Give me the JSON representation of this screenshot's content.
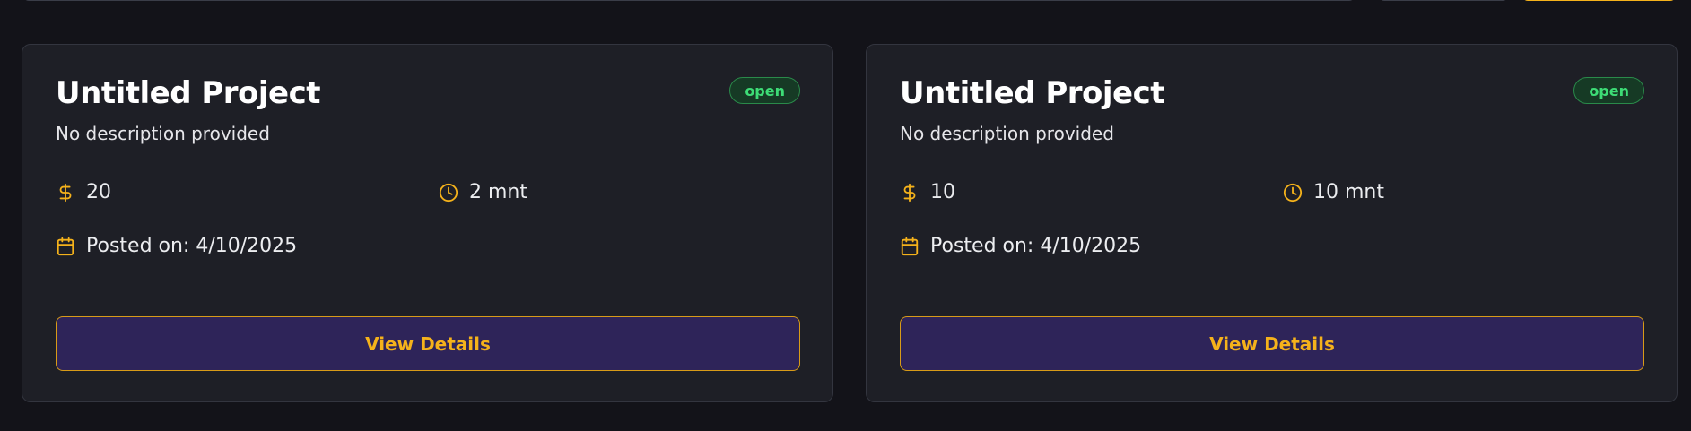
{
  "colors": {
    "accent": "#f5b21b",
    "background": "#131319",
    "card": "#1e1f26",
    "status_open": "#3ddc76",
    "button_bg": "#2e2459"
  },
  "projects": [
    {
      "title": "Untitled Project",
      "description": "No description provided",
      "status": "open",
      "price": "20",
      "duration": "2 mnt",
      "posted": "Posted on: 4/10/2025",
      "button_label": "View Details"
    },
    {
      "title": "Untitled Project",
      "description": "No description provided",
      "status": "open",
      "price": "10",
      "duration": "10 mnt",
      "posted": "Posted on: 4/10/2025",
      "button_label": "View Details"
    }
  ],
  "icons": {
    "price": "dollar-icon",
    "duration": "clock-icon",
    "posted": "calendar-icon"
  }
}
